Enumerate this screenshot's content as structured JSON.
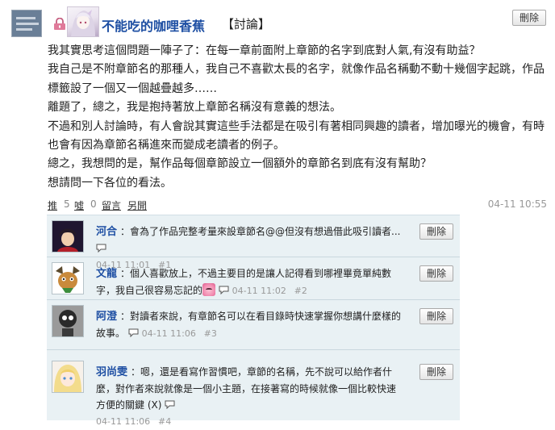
{
  "header": {
    "author": "不能吃的咖哩香蕉",
    "tag": "【討論】",
    "delete_label": "刪除"
  },
  "post": {
    "paragraphs": [
      "我其實思考這個問題一陣子了：在每一章前面附上章節的名字到底對人氣,有沒有助益？",
      "我自己是不附章節名的那種人，我自己不喜歡太長的名字，就像作品名稱動不動十幾個字起跳，作品標籤設了一個又一個越疊越多……",
      "離題了，總之，我是抱持著放上章節名稱沒有意義的想法。",
      "不過和別人討論時，有人會說其實這些手法都是在吸引有著相同興趣的讀者，增加曝光的機會，有時也會有因為章節名稱進來而變成老讀者的例子。",
      "總之，我想問的是，幫作品每個章節設立一個額外的章節名到底有沒有幫助？",
      "想請問一下各位的看法。"
    ]
  },
  "actions": {
    "push_label": "推",
    "push_count": "5",
    "boo_label": "噓",
    "boo_count": "0",
    "reply_label": "留言",
    "link_label": "另開",
    "timestamp": "04-11 10:55"
  },
  "comments": [
    {
      "name": "河合",
      "text": "：會為了作品完整考量來設章節名@@但沒有想過借此吸引讀者...",
      "time": "04-11 11:01",
      "floor": "#1",
      "delete_label": "刪除"
    },
    {
      "name": "文龍",
      "text": "：個人喜歡放上，不過主要目的是讓人記得看到哪裡畢竟單純數字，我自己很容易忘記的",
      "time": "04-11 11:02",
      "floor": "#2",
      "delete_label": "刪除"
    },
    {
      "name": "阿澄",
      "text": "：對讀者來說，有章節名可以在看目錄時快速掌握你想講什麼樣的故事。",
      "time": "04-11 11:06",
      "floor": "#3",
      "delete_label": "刪除"
    },
    {
      "name": "羽尚雯",
      "text": "：嗯，還是看寫作習慣吧，章節的名稱，先不說可以給作者什麼，對作者來說就像是一個小主題，在接著寫的時候就像一個比較快速方便的關鍵 (X)",
      "time": "04-11 11:06",
      "floor": "#4",
      "delete_label": "刪除"
    }
  ],
  "colors": {
    "link_blue": "#1e4fa3",
    "comment_bg": "#e9f1f4",
    "meta_gray": "#999999"
  }
}
